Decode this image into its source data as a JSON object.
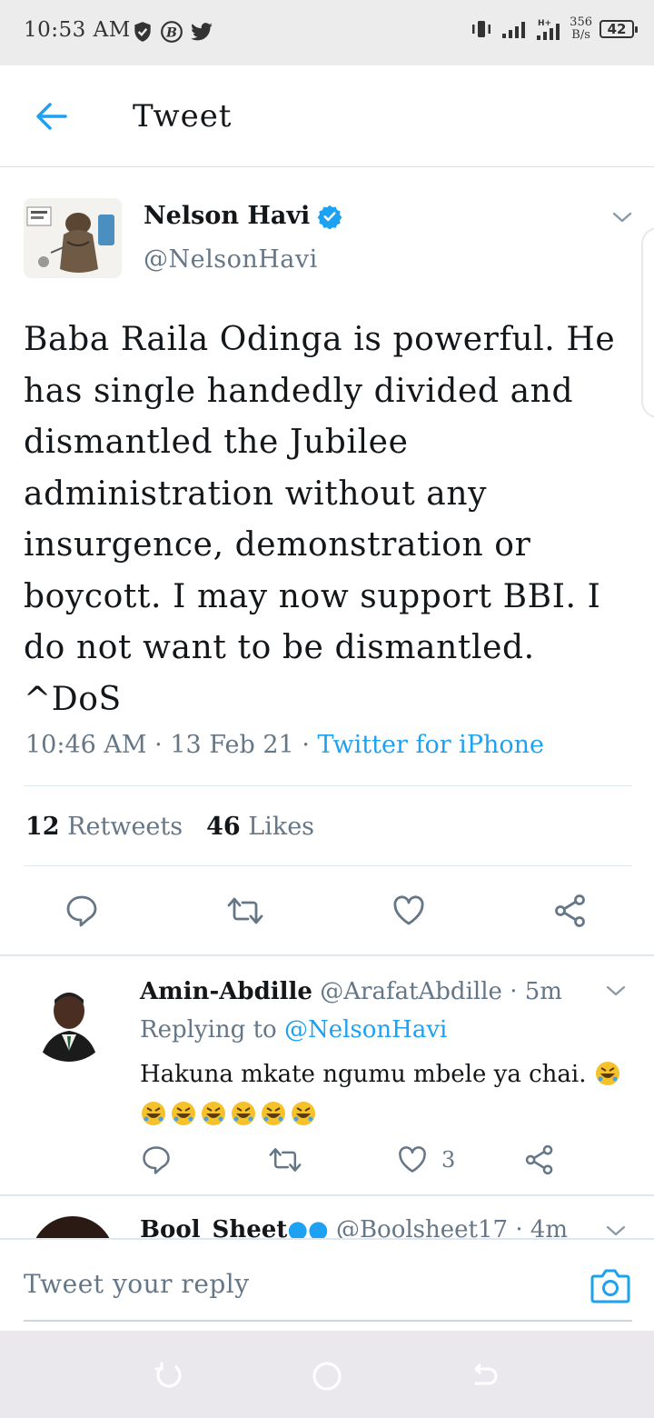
{
  "status_bar": {
    "time": "10:53 AM",
    "net_speed_value": "356",
    "net_speed_unit": "B/s",
    "battery": "42",
    "icons": [
      "shield-icon",
      "b-badge-icon",
      "twitter-bird-icon",
      "vibrate-icon",
      "signal-icon",
      "signal-4g-icon",
      "battery-icon"
    ]
  },
  "header": {
    "title": "Tweet"
  },
  "tweet": {
    "author_name": "Nelson Havi",
    "author_handle": "@NelsonHavi",
    "text": "Baba Raila Odinga is powerful. He has single handedly divided and dismantled the Jubilee administration without any insurgence, demonstration or boycott. I may now support BBI. I do not want to be dismantled. ^DoS",
    "time": "10:46 AM",
    "date": "13 Feb 21",
    "source": "Twitter for iPhone",
    "retweets_count": "12",
    "retweets_label": "Retweets",
    "likes_count": "46",
    "likes_label": "Likes"
  },
  "reply": {
    "name": "Amin-Abdille",
    "handle": "@ArafatAbdille",
    "age": "5m",
    "replying_prefix": "Replying to",
    "replying_to": "@NelsonHavi",
    "text": "Hakuna mkate ngumu mbele ya chai.",
    "likes": "3"
  },
  "reply2": {
    "name": "Bool_Sheet",
    "handle": "@Boolsheet17",
    "age": "4m"
  },
  "compose": {
    "placeholder": "Tweet your reply"
  },
  "colors": {
    "accent": "#1da1f2",
    "text": "#14171a",
    "muted": "#657786",
    "divider": "#e1e8ed"
  }
}
